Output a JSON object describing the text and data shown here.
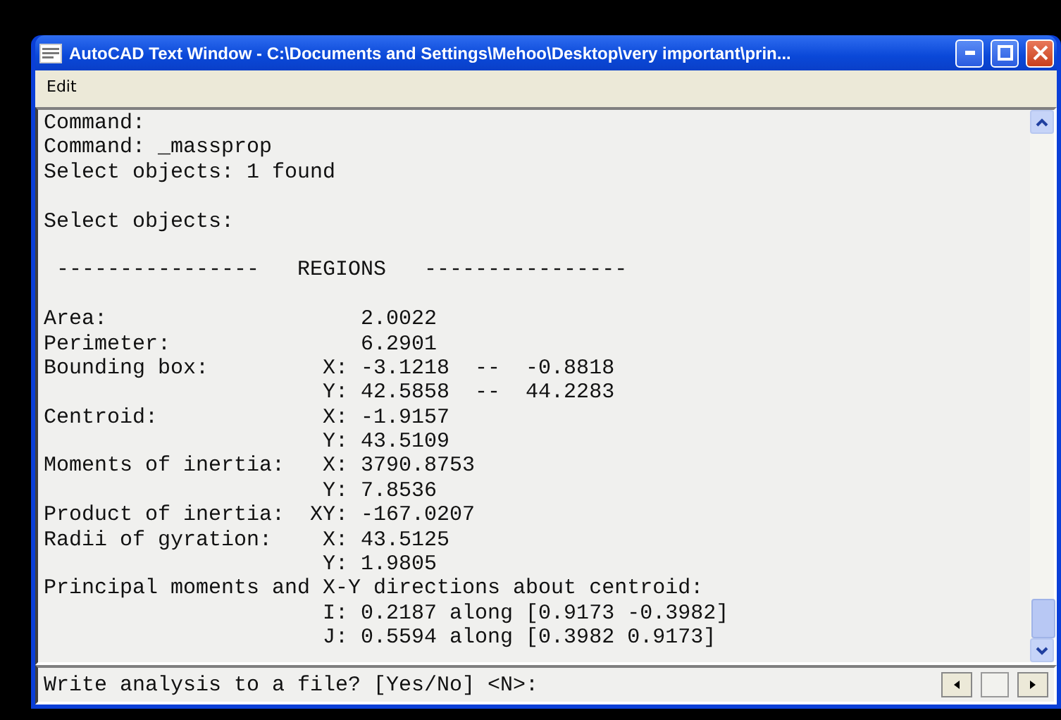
{
  "window": {
    "title": "AutoCAD Text Window - C:\\Documents and Settings\\Mehoo\\Desktop\\very important\\prin..."
  },
  "menu": [
    {
      "label": "Edit"
    }
  ],
  "output_blocks": [
    [
      "Command:",
      "Command: _massprop",
      "Select objects: 1 found"
    ],
    [
      "Select objects:"
    ],
    [
      " ----------------   REGIONS   ----------------"
    ],
    [
      "Area:                    2.0022",
      "Perimeter:               6.2901",
      "Bounding box:         X: -3.1218  --  -0.8818",
      "                      Y: 42.5858  --  44.2283",
      "Centroid:             X: -1.9157",
      "                      Y: 43.5109",
      "Moments of inertia:   X: 3790.8753",
      "                      Y: 7.8536",
      "Product of inertia:  XY: -167.0207",
      "Radii of gyration:    X: 43.5125",
      "                      Y: 1.9805",
      "Principal moments and X-Y directions about centroid:",
      "                      I: 0.2187 along [0.9173 -0.3982]",
      "                      J: 0.5594 along [0.3982 0.9173]"
    ]
  ],
  "command_line": "Write analysis to a file? [Yes/No] <N>:"
}
